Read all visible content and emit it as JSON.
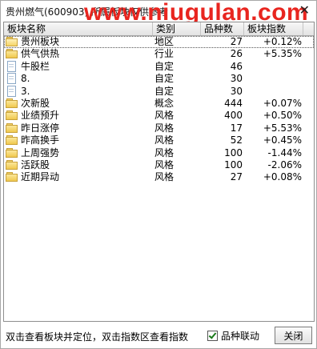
{
  "window": {
    "title": "贵州燃气(600903) 所属板块仅供参考",
    "watermark": "www.niugulan.com",
    "close_symbol": "✕"
  },
  "table": {
    "columns": [
      "板块名称",
      "类别",
      "品种数",
      "板块指数"
    ],
    "rows": [
      {
        "icon": "folder-open-icon",
        "name": "贵州板块",
        "category": "地区",
        "count": "27",
        "index": "+0.12%"
      },
      {
        "icon": "folder-icon",
        "name": "供气供热",
        "category": "行业",
        "count": "26",
        "index": "+5.35%"
      },
      {
        "icon": "document-icon",
        "name": "牛股栏",
        "category": "自定",
        "count": "46",
        "index": ""
      },
      {
        "icon": "document-icon",
        "name": "8.",
        "category": "自定",
        "count": "30",
        "index": ""
      },
      {
        "icon": "document-icon",
        "name": "3.",
        "category": "自定",
        "count": "30",
        "index": ""
      },
      {
        "icon": "folder-icon",
        "name": "次新股",
        "category": "概念",
        "count": "444",
        "index": "+0.07%"
      },
      {
        "icon": "folder-icon",
        "name": "业绩预升",
        "category": "风格",
        "count": "400",
        "index": "+0.50%"
      },
      {
        "icon": "folder-icon",
        "name": "昨日涨停",
        "category": "风格",
        "count": "17",
        "index": "+5.53%"
      },
      {
        "icon": "folder-icon",
        "name": "昨高换手",
        "category": "风格",
        "count": "52",
        "index": "+0.45%"
      },
      {
        "icon": "folder-icon",
        "name": "上周强势",
        "category": "风格",
        "count": "100",
        "index": "-1.44%"
      },
      {
        "icon": "folder-icon",
        "name": "活跃股",
        "category": "风格",
        "count": "100",
        "index": "-2.06%"
      },
      {
        "icon": "folder-icon",
        "name": "近期异动",
        "category": "风格",
        "count": "27",
        "index": "+0.08%"
      }
    ]
  },
  "status": {
    "hint": "双击查看板块并定位，双击指数区查看指数",
    "checkbox_label": "品种联动",
    "checkbox_checked": true,
    "close_button": "关闭"
  }
}
